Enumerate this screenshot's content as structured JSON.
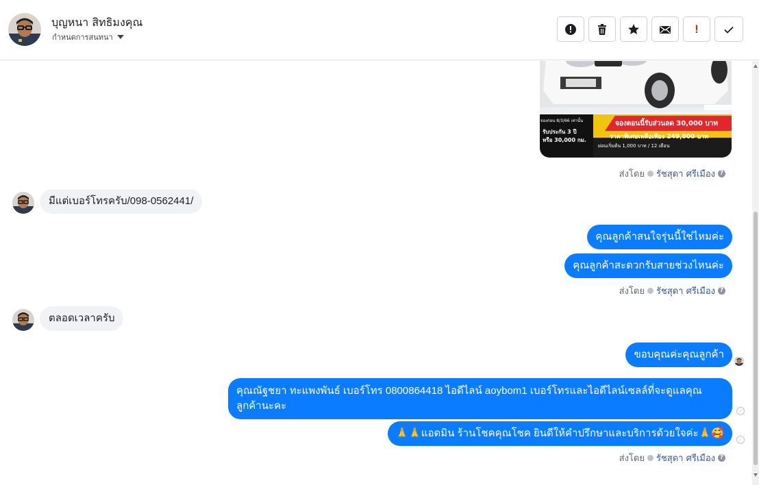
{
  "header": {
    "name": "บุญหนา สิทธิมงคุณ",
    "subtitle": "กำหนดการสนทนา",
    "actions": [
      "alert-circle-icon",
      "trash-icon",
      "star-icon",
      "envelope-icon",
      "exclamation-icon",
      "check-icon"
    ],
    "exclamation_text": "!"
  },
  "image_message": {
    "promo_date": "จองก่อน 8/3/66 เท่านั้น",
    "promo_discount": "จองตอนนี้รับส่วนลด 30,000 บาท",
    "promo_warranty": "รับประกัน 3 ปี",
    "promo_km": "หรือ 30,000 กม.",
    "promo_price": "ราคาพิเศษเหลือเพียง 249,000 บาท",
    "promo_installment": "ผ่อนเริ่มต้น 1,000 บาท / 12 เดือน"
  },
  "messages": {
    "in_1": "มีแต่เบอร์โทรครับ/098-0562441/",
    "out_1": "คุณลูกค้าสนใจรุ่นนี้ใช่ไหมค่ะ",
    "out_2": "คุณลูกค้าสะดวกรับสายช่วงไหนค่ะ",
    "in_2": "ตลอดเวลาครับ",
    "out_3": "ขอบคุณค่ะคุณลูกค้า",
    "out_4": "คุณณัฐชยา ทะแพงพันธ์ เบอร์โทร 0800864418  ไอดีไลน์ aoybom1   เบอร์โทรและไอดีไลน์เซลล์ที่จะดูแลคุณลูกค้านะคะ",
    "out_5": "🙏🙏แอดมิน ร้านโชคคุณโชค ยินดีให้คำปรึกษาและบริการด้วยใจค่ะ🙏🥰"
  },
  "sent_by": {
    "prefix": "ส่งโดย",
    "agent": "รัชสุดา ศรีเมือง"
  },
  "colors": {
    "outgoing_bubble": "#0a7cff",
    "incoming_bubble": "#f0f2f5",
    "link": "#385898"
  }
}
